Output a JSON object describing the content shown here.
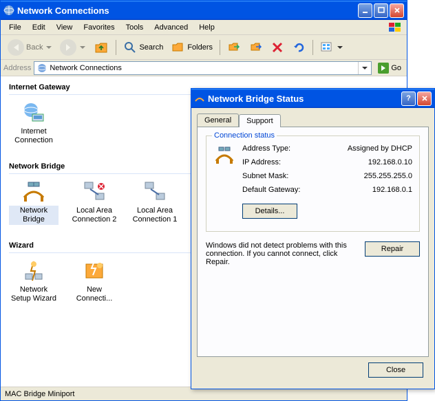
{
  "window": {
    "title": "Network Connections",
    "min": "_",
    "max": "□",
    "close": "×"
  },
  "menu": {
    "file": "File",
    "edit": "Edit",
    "view": "View",
    "favorites": "Favorites",
    "tools": "Tools",
    "advanced": "Advanced",
    "help": "Help"
  },
  "toolbar": {
    "back": "Back",
    "search": "Search",
    "folders": "Folders"
  },
  "address": {
    "label": "Address",
    "value": "Network Connections",
    "go": "Go"
  },
  "sections": {
    "gateway": "Internet Gateway",
    "bridge": "Network Bridge",
    "wizard": "Wizard"
  },
  "items": {
    "internet_connection": "Internet Connection",
    "network_bridge": "Network Bridge",
    "lan2": "Local Area Connection 2",
    "lan1": "Local Area Connection 1",
    "setup_wizard": "Network Setup Wizard",
    "new_conn": "New Connecti..."
  },
  "statusbar": "MAC Bridge Miniport",
  "dialog": {
    "title": "Network Bridge Status",
    "help": "?",
    "close_x": "×",
    "tabs": {
      "general": "General",
      "support": "Support"
    },
    "fieldset_legend": "Connection status",
    "rows": {
      "addr_type_label": "Address Type:",
      "addr_type_value": "Assigned by DHCP",
      "ip_label": "IP Address:",
      "ip_value": "192.168.0.10",
      "mask_label": "Subnet Mask:",
      "mask_value": "255.255.255.0",
      "gw_label": "Default Gateway:",
      "gw_value": "192.168.0.1"
    },
    "details": "Details...",
    "help_text": "Windows did not detect problems with this connection. If you cannot connect, click Repair.",
    "repair": "Repair",
    "close": "Close"
  }
}
